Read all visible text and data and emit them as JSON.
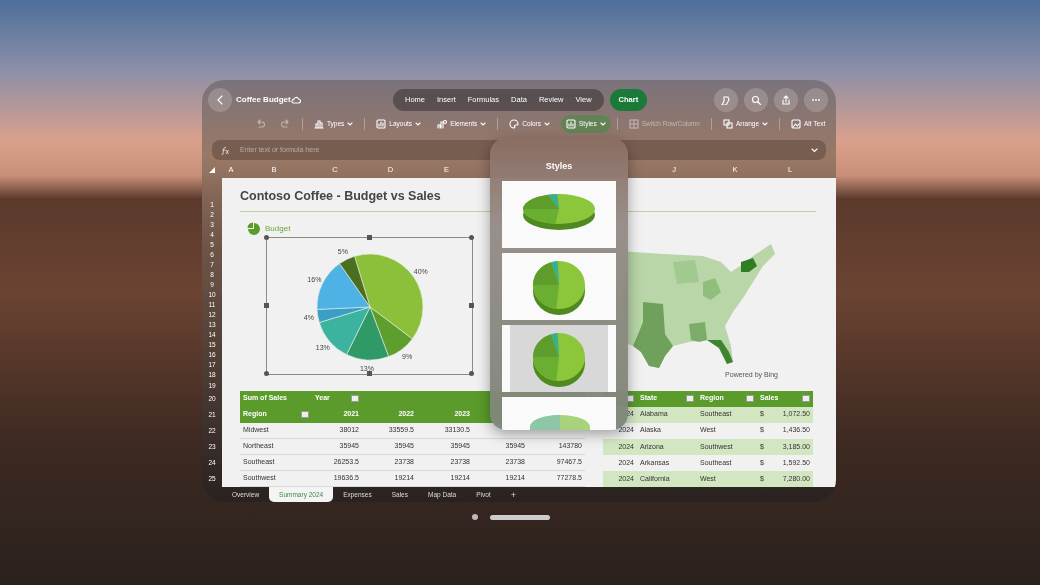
{
  "window": {
    "title": "Coffee Budget"
  },
  "ribbon_tabs": [
    {
      "label": "Home",
      "selected": false
    },
    {
      "label": "Insert",
      "selected": false
    },
    {
      "label": "Formulas",
      "selected": false
    },
    {
      "label": "Data",
      "selected": false
    },
    {
      "label": "Review",
      "selected": false
    },
    {
      "label": "View",
      "selected": false
    },
    {
      "label": "Chart",
      "selected": true
    }
  ],
  "toolbar_groups": [
    [
      {
        "kind": "undo",
        "disabled": true,
        "selected": false
      },
      {
        "kind": "redo",
        "disabled": true,
        "selected": false
      }
    ],
    [
      {
        "kind": "types",
        "label": "Types",
        "dropdown": true,
        "disabled": false,
        "selected": false
      }
    ],
    [
      {
        "kind": "layouts",
        "label": "Layouts",
        "dropdown": true,
        "disabled": false,
        "selected": false
      },
      {
        "kind": "elements",
        "label": "Elements",
        "dropdown": true,
        "disabled": false,
        "selected": false
      }
    ],
    [
      {
        "kind": "colors",
        "label": "Colors",
        "dropdown": true,
        "disabled": false,
        "selected": false
      },
      {
        "kind": "styles",
        "label": "Styles",
        "dropdown": true,
        "disabled": false,
        "selected": true
      }
    ],
    [
      {
        "kind": "switch",
        "label": "Switch Row/Column",
        "dropdown": false,
        "disabled": true,
        "selected": false
      }
    ],
    [
      {
        "kind": "arrange",
        "label": "Arrange",
        "dropdown": true,
        "disabled": false,
        "selected": false
      }
    ],
    [
      {
        "kind": "alttext",
        "label": "Alt Text",
        "dropdown": false,
        "disabled": false,
        "selected": false
      }
    ]
  ],
  "formula_bar": {
    "placeholder": "Enter text or formula here"
  },
  "column_headers": [
    "A",
    "B",
    "C",
    "D",
    "E",
    "J",
    "K",
    "L"
  ],
  "row_numbers": [
    "1",
    "2",
    "3",
    "4",
    "5",
    "6",
    "7",
    "8",
    "9",
    "10",
    "11",
    "12",
    "13",
    "14",
    "15",
    "16",
    "17",
    "18",
    "19",
    "20",
    "21",
    "22",
    "23",
    "24",
    "25"
  ],
  "sheet": {
    "title": "Contoso Coffee - Budget vs Sales",
    "chart": {
      "chart_data": {
        "type": "pie",
        "title": "Budget",
        "values": [
          40,
          9,
          13,
          13,
          4,
          16,
          5
        ],
        "data_labels": true,
        "value_labels": [
          "40%",
          "9%",
          "13%",
          "13%",
          "4%",
          "16%",
          "5%"
        ]
      }
    },
    "map": {
      "credit": "Powered by Bing"
    }
  },
  "pivot_table": {
    "header_rows": [
      [
        {
          "text": "Sum of Sales",
          "filter": false
        },
        {
          "text": "Year",
          "filter": true
        }
      ],
      [
        {
          "text": "Region",
          "filter": true
        },
        {
          "text": "2021",
          "filter": false
        },
        {
          "text": "2022",
          "filter": false
        },
        {
          "text": "2023",
          "filter": false
        }
      ]
    ],
    "rows": [
      [
        "Midwest",
        "38012",
        "33559.5",
        "33130.5"
      ],
      [
        "Northeast",
        "35945",
        "35945",
        "35945",
        "35945",
        "143780"
      ],
      [
        "Southeast",
        "26253.5",
        "23738",
        "23738",
        "23738",
        "97467.5"
      ],
      [
        "Southwest",
        "19636.5",
        "19214",
        "19214",
        "19214",
        "77278.5"
      ]
    ]
  },
  "sales_table": {
    "columns": [
      {
        "filter": true
      },
      {
        "label": "State",
        "filter": true
      },
      {
        "label": "Region",
        "filter": true
      },
      {
        "label": "Sales",
        "filter": true
      }
    ],
    "rows": [
      {
        "year": "24",
        "state": "Alabama",
        "region": "Southeast",
        "currency": "$",
        "sales": "1,072.50"
      },
      {
        "year": "2024",
        "state": "Alaska",
        "region": "West",
        "currency": "$",
        "sales": "1,436.50"
      },
      {
        "year": "2024",
        "state": "Arizona",
        "region": "Southwest",
        "currency": "$",
        "sales": "3,185.00"
      },
      {
        "year": "2024",
        "state": "Arkansas",
        "region": "Southeast",
        "currency": "$",
        "sales": "1,592.50"
      },
      {
        "year": "2024",
        "state": "California",
        "region": "West",
        "currency": "$",
        "sales": "7,280.00"
      }
    ]
  },
  "styles_panel": {
    "title": "Styles",
    "thumbnails": [
      {
        "kind": "flat3d"
      },
      {
        "kind": "labels3d"
      },
      {
        "kind": "shaded"
      },
      {
        "kind": "partial"
      }
    ]
  },
  "sheet_tabs": [
    {
      "label": "Overview",
      "selected": false
    },
    {
      "label": "Summary 2024",
      "selected": true
    },
    {
      "label": "Expenses",
      "selected": false
    },
    {
      "label": "Sales",
      "selected": false
    },
    {
      "label": "Map Data",
      "selected": false
    },
    {
      "label": "Pivot",
      "selected": false
    }
  ],
  "add_sheet": "+"
}
